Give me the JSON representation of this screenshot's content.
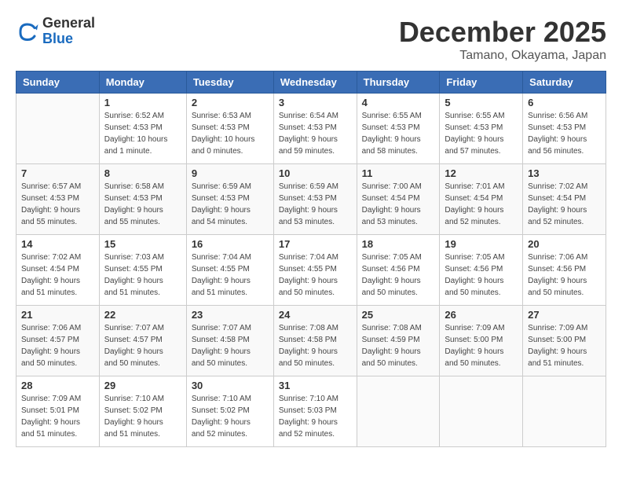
{
  "header": {
    "logo_general": "General",
    "logo_blue": "Blue",
    "month_title": "December 2025",
    "location": "Tamano, Okayama, Japan"
  },
  "days_of_week": [
    "Sunday",
    "Monday",
    "Tuesday",
    "Wednesday",
    "Thursday",
    "Friday",
    "Saturday"
  ],
  "weeks": [
    [
      {
        "day": "",
        "info": ""
      },
      {
        "day": "1",
        "info": "Sunrise: 6:52 AM\nSunset: 4:53 PM\nDaylight: 10 hours\nand 1 minute."
      },
      {
        "day": "2",
        "info": "Sunrise: 6:53 AM\nSunset: 4:53 PM\nDaylight: 10 hours\nand 0 minutes."
      },
      {
        "day": "3",
        "info": "Sunrise: 6:54 AM\nSunset: 4:53 PM\nDaylight: 9 hours\nand 59 minutes."
      },
      {
        "day": "4",
        "info": "Sunrise: 6:55 AM\nSunset: 4:53 PM\nDaylight: 9 hours\nand 58 minutes."
      },
      {
        "day": "5",
        "info": "Sunrise: 6:55 AM\nSunset: 4:53 PM\nDaylight: 9 hours\nand 57 minutes."
      },
      {
        "day": "6",
        "info": "Sunrise: 6:56 AM\nSunset: 4:53 PM\nDaylight: 9 hours\nand 56 minutes."
      }
    ],
    [
      {
        "day": "7",
        "info": "Sunrise: 6:57 AM\nSunset: 4:53 PM\nDaylight: 9 hours\nand 55 minutes."
      },
      {
        "day": "8",
        "info": "Sunrise: 6:58 AM\nSunset: 4:53 PM\nDaylight: 9 hours\nand 55 minutes."
      },
      {
        "day": "9",
        "info": "Sunrise: 6:59 AM\nSunset: 4:53 PM\nDaylight: 9 hours\nand 54 minutes."
      },
      {
        "day": "10",
        "info": "Sunrise: 6:59 AM\nSunset: 4:53 PM\nDaylight: 9 hours\nand 53 minutes."
      },
      {
        "day": "11",
        "info": "Sunrise: 7:00 AM\nSunset: 4:54 PM\nDaylight: 9 hours\nand 53 minutes."
      },
      {
        "day": "12",
        "info": "Sunrise: 7:01 AM\nSunset: 4:54 PM\nDaylight: 9 hours\nand 52 minutes."
      },
      {
        "day": "13",
        "info": "Sunrise: 7:02 AM\nSunset: 4:54 PM\nDaylight: 9 hours\nand 52 minutes."
      }
    ],
    [
      {
        "day": "14",
        "info": "Sunrise: 7:02 AM\nSunset: 4:54 PM\nDaylight: 9 hours\nand 51 minutes."
      },
      {
        "day": "15",
        "info": "Sunrise: 7:03 AM\nSunset: 4:55 PM\nDaylight: 9 hours\nand 51 minutes."
      },
      {
        "day": "16",
        "info": "Sunrise: 7:04 AM\nSunset: 4:55 PM\nDaylight: 9 hours\nand 51 minutes."
      },
      {
        "day": "17",
        "info": "Sunrise: 7:04 AM\nSunset: 4:55 PM\nDaylight: 9 hours\nand 50 minutes."
      },
      {
        "day": "18",
        "info": "Sunrise: 7:05 AM\nSunset: 4:56 PM\nDaylight: 9 hours\nand 50 minutes."
      },
      {
        "day": "19",
        "info": "Sunrise: 7:05 AM\nSunset: 4:56 PM\nDaylight: 9 hours\nand 50 minutes."
      },
      {
        "day": "20",
        "info": "Sunrise: 7:06 AM\nSunset: 4:56 PM\nDaylight: 9 hours\nand 50 minutes."
      }
    ],
    [
      {
        "day": "21",
        "info": "Sunrise: 7:06 AM\nSunset: 4:57 PM\nDaylight: 9 hours\nand 50 minutes."
      },
      {
        "day": "22",
        "info": "Sunrise: 7:07 AM\nSunset: 4:57 PM\nDaylight: 9 hours\nand 50 minutes."
      },
      {
        "day": "23",
        "info": "Sunrise: 7:07 AM\nSunset: 4:58 PM\nDaylight: 9 hours\nand 50 minutes."
      },
      {
        "day": "24",
        "info": "Sunrise: 7:08 AM\nSunset: 4:58 PM\nDaylight: 9 hours\nand 50 minutes."
      },
      {
        "day": "25",
        "info": "Sunrise: 7:08 AM\nSunset: 4:59 PM\nDaylight: 9 hours\nand 50 minutes."
      },
      {
        "day": "26",
        "info": "Sunrise: 7:09 AM\nSunset: 5:00 PM\nDaylight: 9 hours\nand 50 minutes."
      },
      {
        "day": "27",
        "info": "Sunrise: 7:09 AM\nSunset: 5:00 PM\nDaylight: 9 hours\nand 51 minutes."
      }
    ],
    [
      {
        "day": "28",
        "info": "Sunrise: 7:09 AM\nSunset: 5:01 PM\nDaylight: 9 hours\nand 51 minutes."
      },
      {
        "day": "29",
        "info": "Sunrise: 7:10 AM\nSunset: 5:02 PM\nDaylight: 9 hours\nand 51 minutes."
      },
      {
        "day": "30",
        "info": "Sunrise: 7:10 AM\nSunset: 5:02 PM\nDaylight: 9 hours\nand 52 minutes."
      },
      {
        "day": "31",
        "info": "Sunrise: 7:10 AM\nSunset: 5:03 PM\nDaylight: 9 hours\nand 52 minutes."
      },
      {
        "day": "",
        "info": ""
      },
      {
        "day": "",
        "info": ""
      },
      {
        "day": "",
        "info": ""
      }
    ]
  ]
}
